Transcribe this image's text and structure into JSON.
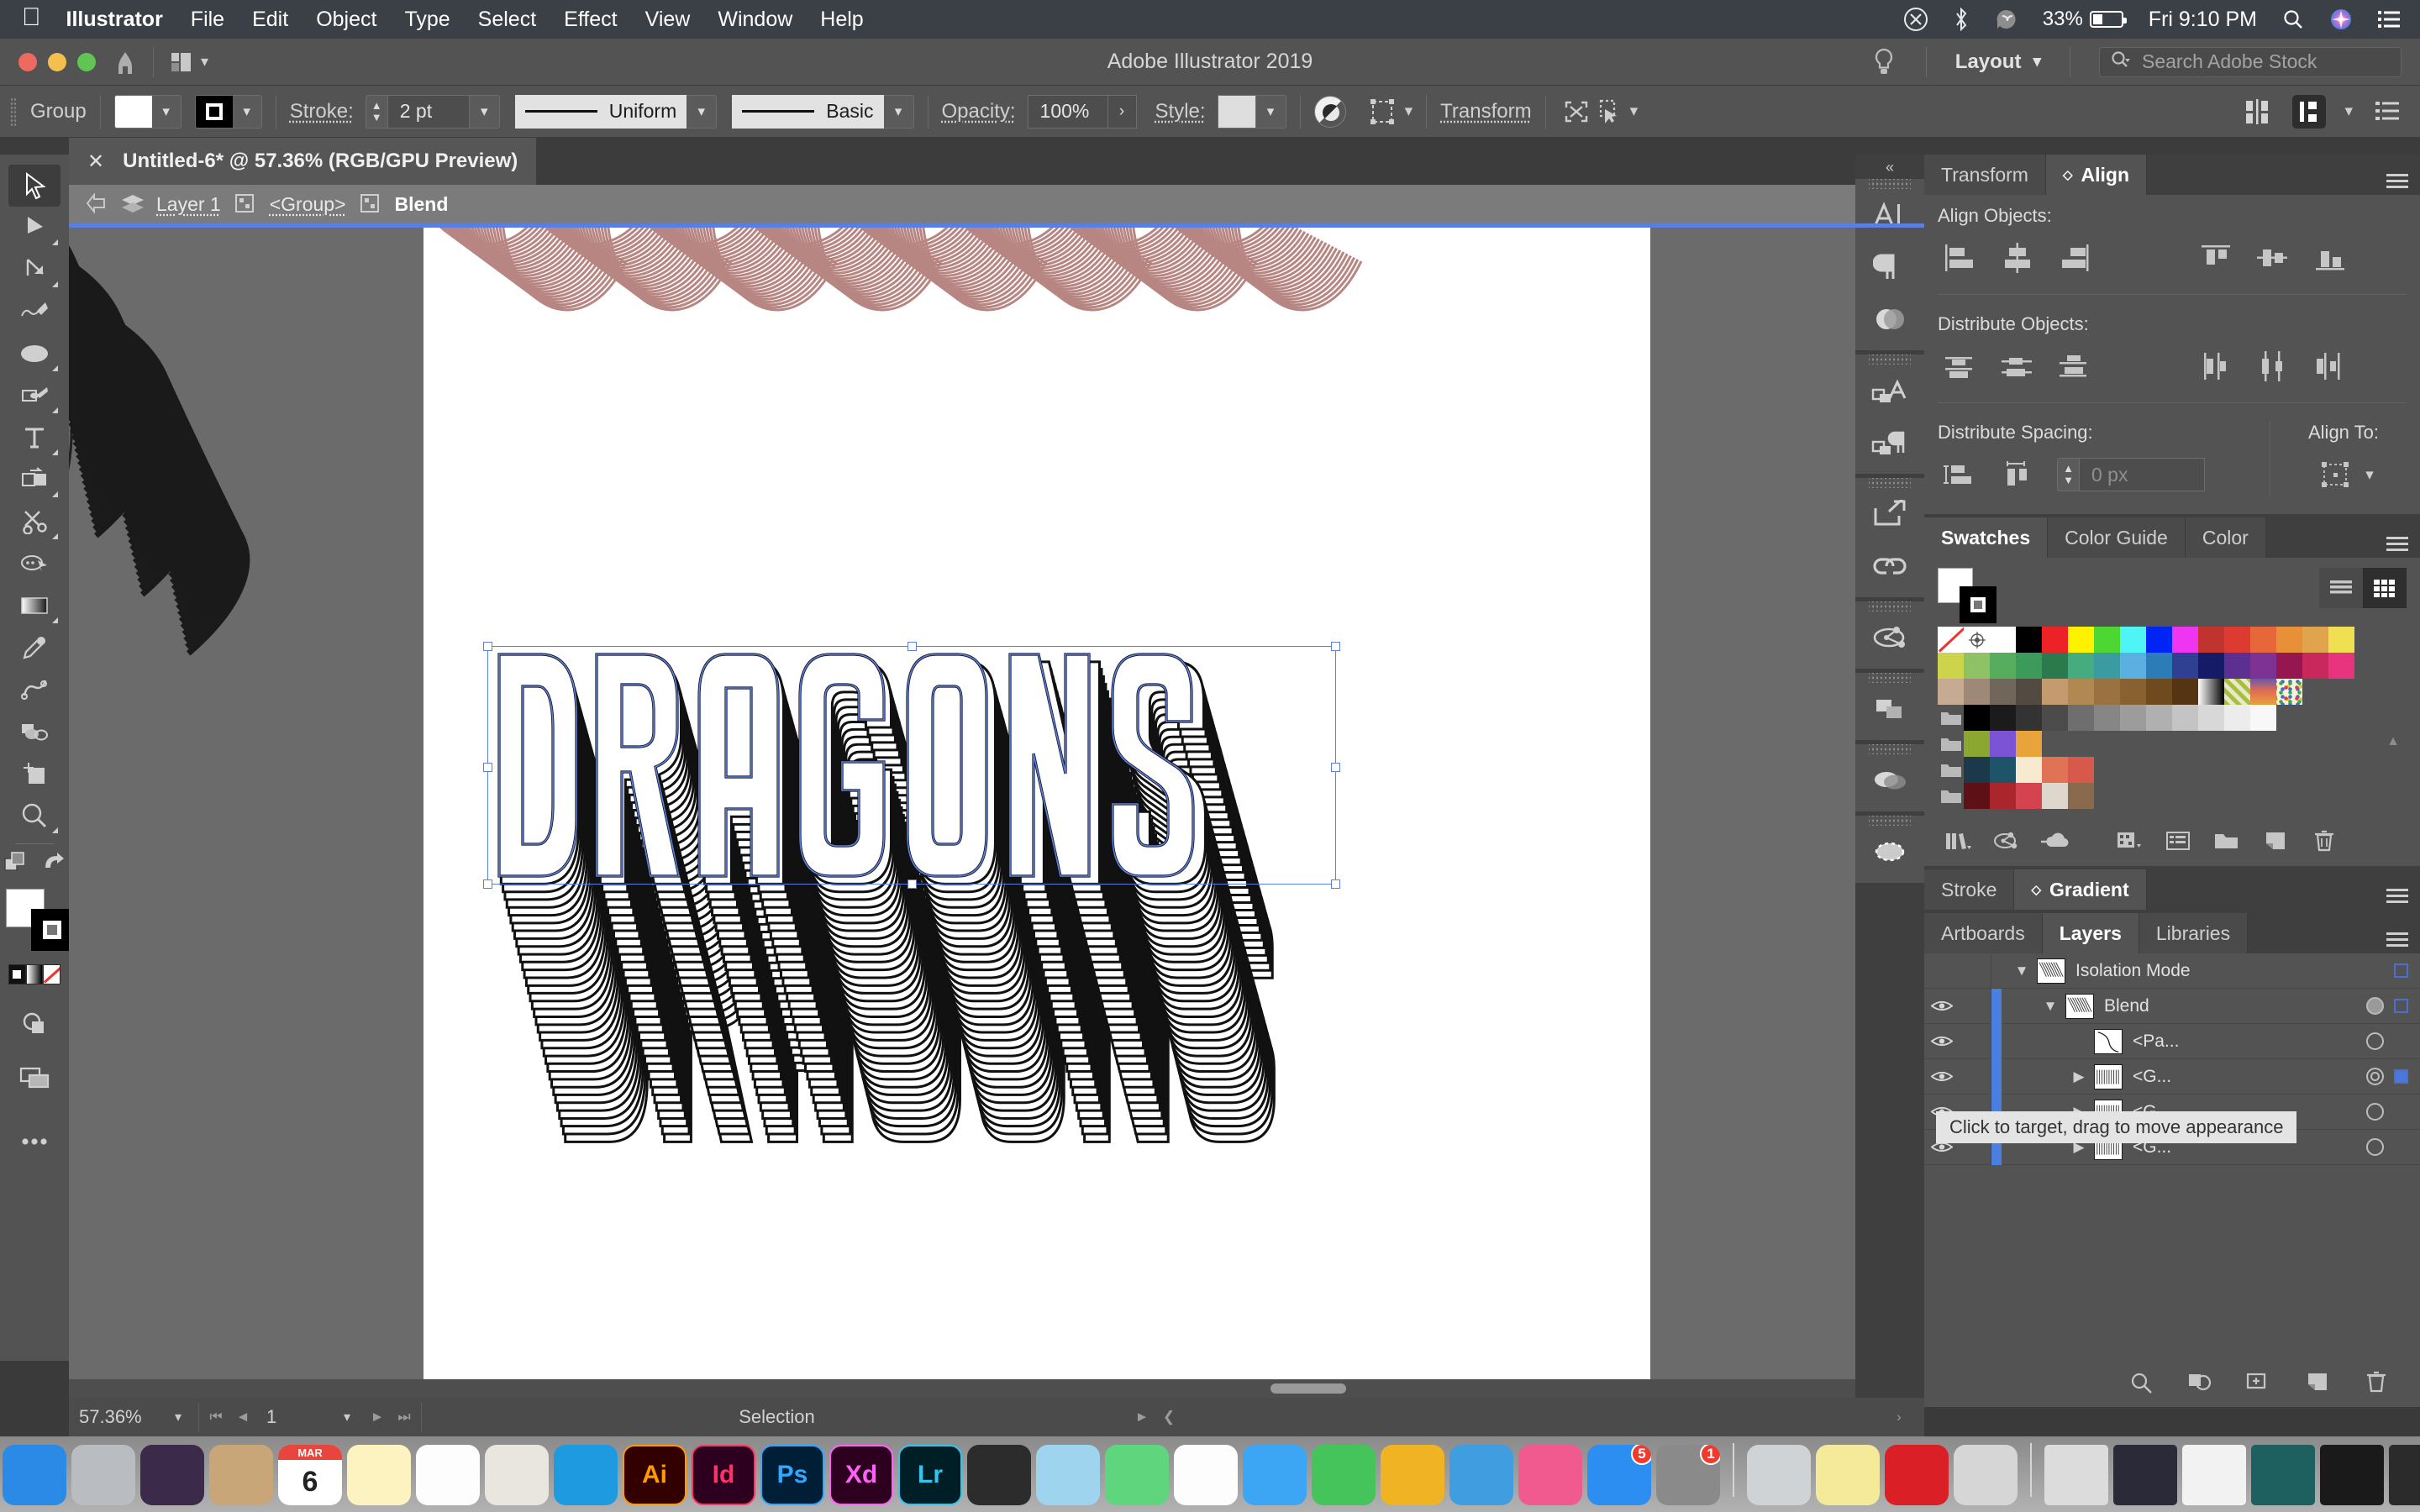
{
  "menubar": {
    "apple_icon": "apple-logo",
    "app_name": "Illustrator",
    "items": [
      "File",
      "Edit",
      "Object",
      "Type",
      "Select",
      "Effect",
      "View",
      "Window",
      "Help"
    ],
    "status": {
      "creative_cloud_icon": "creative-cloud-icon",
      "bluetooth_icon": "bluetooth-icon",
      "evernote_icon": "evernote-icon",
      "battery_percent": "33%",
      "clock": "Fri 9:10 PM",
      "search_icon": "spotlight-search-icon",
      "siri_icon": "siri-icon",
      "control_center_icon": "notification-center-icon"
    }
  },
  "titlebar": {
    "title": "Adobe Illustrator 2019",
    "home_icon": "home-icon",
    "arrange_icon": "arrange-documents-icon",
    "bulb_icon": "lightbulb-tips-icon",
    "workspace": "Layout",
    "search_placeholder": "Search Adobe Stock",
    "search_icon": "search-icon"
  },
  "controlbar": {
    "selection_label": "Group",
    "fill_label": "fill-swatch",
    "stroke_label": "stroke-swatch",
    "stroke_text": "Stroke:",
    "stroke_weight": "2 pt",
    "profile": "Uniform",
    "brush": "Basic",
    "opacity_label": "Opacity:",
    "opacity_value": "100%",
    "style_label": "Style:",
    "opacity_icon": "opacity-mask-icon",
    "recolor_icon": "recolor-artwork-icon",
    "transform_label": "Transform",
    "isolate_icon": "isolate-selected-object-icon",
    "select_similar_icon": "select-similar-objects-icon",
    "align_icon": "align-icon",
    "distribute_icon": "distribute-icon",
    "options_icon": "document-setup-icon"
  },
  "document": {
    "tab_title": "Untitled-6* @ 57.36% (RGB/GPU Preview)",
    "close_icon": "close-tab-icon"
  },
  "breadcrumb": {
    "back_icon": "back-arrow-icon",
    "layers_icon": "layers-stack-icon",
    "items": [
      {
        "label": "Layer 1",
        "current": false
      },
      {
        "label": "<Group>",
        "current": false
      },
      {
        "label": "Blend",
        "current": true
      }
    ]
  },
  "toolbar": {
    "tools": [
      {
        "name": "selection-tool",
        "selected": true,
        "has_flyout": false
      },
      {
        "name": "direct-selection-tool",
        "selected": false,
        "has_flyout": true
      },
      {
        "name": "pen-tool-anchor",
        "selected": false,
        "has_flyout": true
      },
      {
        "name": "curvature-tool",
        "selected": false,
        "has_flyout": false
      },
      {
        "name": "ellipse-tool",
        "selected": false,
        "has_flyout": true
      },
      {
        "name": "paintbrush-tool",
        "selected": false,
        "has_flyout": true
      },
      {
        "name": "type-tool",
        "selected": false,
        "has_flyout": true
      },
      {
        "name": "shape-builder-tool",
        "selected": false,
        "has_flyout": true
      },
      {
        "name": "scissors-tool",
        "selected": false,
        "has_flyout": true
      },
      {
        "name": "rotate-tool",
        "selected": false,
        "has_flyout": false
      },
      {
        "name": "gradient-tool",
        "selected": false,
        "has_flyout": true
      },
      {
        "name": "eyedropper-tool",
        "selected": false,
        "has_flyout": false
      },
      {
        "name": "blend-tool",
        "selected": false,
        "has_flyout": false
      },
      {
        "name": "symbol-sprayer-tool",
        "selected": false,
        "has_flyout": false
      },
      {
        "name": "artboard-tool",
        "selected": false,
        "has_flyout": false
      },
      {
        "name": "zoom-tool",
        "selected": false,
        "has_flyout": true
      }
    ],
    "fill_color": "#ffffff",
    "stroke_color": "#000000",
    "swap_icon": "swap-fill-stroke-icon",
    "default_icon": "default-fill-stroke-icon",
    "color_mode_icon": "color-mode-icon",
    "gradient_mode_icon": "gradient-mode-icon",
    "none_mode_icon": "none-mode-icon",
    "drawing_mode_icon": "drawing-modes-icon",
    "screen_mode_icon": "screen-mode-icon",
    "more_icon": "edit-toolbar-icon"
  },
  "canvas": {
    "artwork_text": "DRAGONS",
    "artwork_stroke_color": "#000000",
    "artwork_accent_color": "#b5807c",
    "selection_color": "#5b7fe0",
    "artboard_color": "#ffffff",
    "canvas_color": "#6b6b6b"
  },
  "statusbar": {
    "zoom": "57.36%",
    "page": "1",
    "status_text": "Selection",
    "first_icon": "first-artboard-icon",
    "prev_icon": "previous-artboard-icon",
    "next_icon": "next-artboard-icon",
    "last_icon": "last-artboard-icon"
  },
  "iconrail": {
    "collapse_icon": "collapse-panels-icon",
    "groups": [
      {
        "icons": [
          "character-panel-icon",
          "paragraph-panel-icon",
          "opacity-panel-icon"
        ]
      },
      {
        "icons": [
          "text-wrap-icon",
          "paragraph-styles-icon"
        ]
      },
      {
        "icons": [
          "export-panel-icon",
          "links-panel-icon"
        ]
      },
      {
        "icons": [
          "symbols-panel-icon"
        ]
      },
      {
        "icons": [
          "pathfinder-panel-icon"
        ]
      },
      {
        "icons": [
          "transparency-panel-icon"
        ]
      },
      {
        "icons": [
          "image-trace-panel-icon"
        ]
      }
    ]
  },
  "align_panel": {
    "tabs": [
      {
        "label": "Transform",
        "active": false
      },
      {
        "label": "Align",
        "active": true
      }
    ],
    "menu_icon": "panel-menu-icon",
    "align_objects_label": "Align Objects:",
    "distribute_objects_label": "Distribute Objects:",
    "distribute_spacing_label": "Distribute Spacing:",
    "align_to_label": "Align To:",
    "spacing_value": "0 px",
    "align_buttons": [
      "align-left-edges",
      "align-horizontal-center",
      "align-right-edges",
      "align-top-edges",
      "align-vertical-center",
      "align-bottom-edges"
    ],
    "distribute_buttons": [
      "distribute-top-edges",
      "distribute-vertical-centers",
      "distribute-bottom-edges",
      "distribute-left-edges",
      "distribute-horizontal-centers",
      "distribute-right-edges"
    ],
    "spacing_buttons": [
      "distribute-vertical-space",
      "distribute-horizontal-space"
    ],
    "align_to_icon": "align-to-selection-icon"
  },
  "swatches_panel": {
    "tabs": [
      {
        "label": "Swatches",
        "active": true
      },
      {
        "label": "Color Guide",
        "active": false
      },
      {
        "label": "Color",
        "active": false
      }
    ],
    "menu_icon": "panel-menu-icon",
    "list_view_icon": "list-view-icon",
    "grid_view_icon": "grid-view-icon",
    "rows": [
      {
        "type": "swatches",
        "colors": [
          "none",
          "registration",
          "#ffffff",
          "#000000",
          "#ec2227",
          "#fff200",
          "#4cd733",
          "#4ff4f7",
          "#0024f4",
          "#ef34f2",
          "#c0332f",
          "#dd3b32",
          "#e8673a",
          "#e79038",
          "#e0a44c",
          "#efe052"
        ]
      },
      {
        "type": "swatches",
        "colors": [
          "#ccd44b",
          "#8fc264",
          "#56ad5e",
          "#3c9b5b",
          "#2b7a4e",
          "#44ac7f",
          "#3a9ba0",
          "#5ab0e0",
          "#2c7cb8",
          "#2f3f92",
          "#151b66",
          "#5b3092",
          "#7e3294",
          "#94174f",
          "#c9285c",
          "#e8337e"
        ]
      },
      {
        "type": "swatches",
        "colors": [
          "#c6ab93",
          "#9e8877",
          "#70665a",
          "#534b42",
          "#c49b6f",
          "#b08851",
          "#9a7140",
          "#87612f",
          "#6e4a1e",
          "#543413",
          "gradient-white-black",
          "gradient-check-green",
          "gradient-sunset",
          "pattern-confetti"
        ]
      },
      {
        "type": "folder",
        "folder_icon": "swatch-group-folder",
        "colors": [
          "#000000",
          "#1b1b1b",
          "#333333",
          "#4b4b4b",
          "#6e6e6e",
          "#868686",
          "#9c9c9c",
          "#b0b0b0",
          "#c4c4c4",
          "#d8d8d8",
          "#ececec",
          "#f8f8f8"
        ]
      },
      {
        "type": "folder",
        "folder_icon": "swatch-group-folder",
        "colors": [
          "#8ba730",
          "#7b54d6",
          "#e8a43a"
        ]
      },
      {
        "type": "folder",
        "folder_icon": "swatch-group-folder",
        "colors": [
          "#1b394b",
          "#1f5468",
          "#f7ead0",
          "#e07256",
          "#d6594b"
        ]
      },
      {
        "type": "folder",
        "folder_icon": "swatch-group-folder",
        "colors": [
          "#5d1117",
          "#a8262c",
          "#d4444f",
          "#ddd7ce",
          "#8a6a4c"
        ]
      }
    ],
    "toolbar_icons": [
      "swatch-libraries-icon",
      "color-group-link-icon",
      "add-to-cc-library-icon",
      "show-swatch-kinds-icon",
      "swatch-options-icon",
      "new-color-group-icon",
      "new-swatch-icon",
      "delete-swatch-icon"
    ]
  },
  "gradient_panel": {
    "tabs": [
      {
        "label": "Stroke",
        "active": false
      },
      {
        "label": "Gradient",
        "active": true
      }
    ],
    "menu_icon": "panel-menu-icon"
  },
  "layers_panel": {
    "tabs": [
      {
        "label": "Artboards",
        "active": false
      },
      {
        "label": "Layers",
        "active": true
      },
      {
        "label": "Libraries",
        "active": false
      }
    ],
    "menu_icon": "panel-menu-icon",
    "rows": [
      {
        "name": "Isolation Mode",
        "indent": 0,
        "eye": false,
        "expanded": true,
        "arrow": "chevron-down",
        "target": "none",
        "select_square": "outline",
        "thumb": "blend-art-thumb"
      },
      {
        "name": "Blend",
        "indent": 1,
        "eye": true,
        "expanded": true,
        "arrow": "chevron-down",
        "target": "filled",
        "select_square": "outline",
        "thumb": "blend-art-thumb"
      },
      {
        "name": "<Pa...",
        "indent": 2,
        "eye": true,
        "expanded": false,
        "arrow": "none",
        "target": "empty",
        "select_square": "none",
        "thumb": "path-curve-thumb"
      },
      {
        "name": "<G...",
        "indent": 2,
        "eye": true,
        "expanded": false,
        "arrow": "chevron-right",
        "target": "double",
        "select_square": "filled",
        "thumb": "group-art-thumb"
      },
      {
        "name": "<G...",
        "indent": 2,
        "eye": true,
        "expanded": false,
        "arrow": "chevron-right",
        "target": "empty",
        "select_square": "none",
        "thumb": "group-art-thumb"
      },
      {
        "name": "<G...",
        "indent": 2,
        "eye": true,
        "expanded": false,
        "arrow": "chevron-right",
        "target": "empty",
        "select_square": "none",
        "thumb": "group-art-thumb"
      }
    ],
    "tooltip": "Click to target, drag to move appearance",
    "footer_icons": [
      "locate-object-icon",
      "make-clipping-mask-icon",
      "create-new-sublayer-icon",
      "create-new-layer-icon",
      "delete-selection-icon"
    ]
  },
  "dock": {
    "items": [
      {
        "name": "finder",
        "label": "",
        "color": "#2a8ae5",
        "running": true
      },
      {
        "name": "launchpad",
        "label": "",
        "color": "#b9bcc1",
        "running": false
      },
      {
        "name": "siri",
        "label": "",
        "color": "#3b2a4a",
        "running": false
      },
      {
        "name": "contacts",
        "label": "",
        "color": "#c8a678",
        "running": false
      },
      {
        "name": "calendar",
        "label": "6",
        "color": "#ffffff",
        "running": true
      },
      {
        "name": "notes",
        "label": "",
        "color": "#fcf3c0",
        "running": false
      },
      {
        "name": "reminders",
        "label": "",
        "color": "#fdfdfd",
        "running": false
      },
      {
        "name": "maps",
        "label": "",
        "color": "#e8e6de",
        "running": true
      },
      {
        "name": "safari",
        "label": "",
        "color": "#1d9ae0",
        "running": true
      },
      {
        "name": "illustrator",
        "label": "Ai",
        "color": "#330000",
        "running": true
      },
      {
        "name": "indesign",
        "label": "Id",
        "color": "#2e001f",
        "running": false
      },
      {
        "name": "photoshop",
        "label": "Ps",
        "color": "#001e36",
        "running": false
      },
      {
        "name": "xd",
        "label": "Xd",
        "color": "#2e001f",
        "running": false
      },
      {
        "name": "lightroom",
        "label": "Lr",
        "color": "#001e26",
        "running": false
      },
      {
        "name": "figma",
        "label": "",
        "color": "#2c2c2c",
        "running": false
      },
      {
        "name": "procreate",
        "label": "",
        "color": "#9fd4ef",
        "running": false
      },
      {
        "name": "spotify",
        "label": "",
        "color": "#5fd67e",
        "running": true
      },
      {
        "name": "photos",
        "label": "",
        "color": "#fdfdfd",
        "running": false
      },
      {
        "name": "messages",
        "label": "",
        "color": "#3ca6f4",
        "running": false
      },
      {
        "name": "facetime",
        "label": "",
        "color": "#45c45b",
        "running": false
      },
      {
        "name": "pages",
        "label": "",
        "color": "#f0b323",
        "running": true
      },
      {
        "name": "keynote",
        "label": "",
        "color": "#3f9de0",
        "running": false
      },
      {
        "name": "itunes",
        "label": "",
        "color": "#f05a8e",
        "running": false
      },
      {
        "name": "app-store",
        "label": "",
        "color": "#2c8ef0",
        "badge": "5",
        "running": false
      },
      {
        "name": "system-preferences",
        "label": "",
        "color": "#8a8a8a",
        "badge": "1",
        "running": false
      },
      {
        "name": "preview-folder",
        "label": "",
        "color": "#cfd3d6",
        "running": true
      },
      {
        "name": "stickies",
        "label": "",
        "color": "#f5ea9a",
        "running": true
      },
      {
        "name": "creative-cloud",
        "label": "",
        "color": "#da1f26",
        "running": false
      },
      {
        "name": "printer",
        "label": "",
        "color": "#d6d6d6",
        "running": true
      },
      {
        "name": "window-1",
        "label": "",
        "color": "#dcdcdc",
        "running": false
      },
      {
        "name": "window-2",
        "label": "",
        "color": "#2a2a38",
        "running": false
      },
      {
        "name": "window-3",
        "label": "",
        "color": "#f2f2f2",
        "running": false
      },
      {
        "name": "window-4",
        "label": "",
        "color": "#1e5f5f",
        "running": false
      },
      {
        "name": "window-5",
        "label": "",
        "color": "#1a1a1a",
        "running": false
      },
      {
        "name": "window-6",
        "label": "",
        "color": "#2b2b2b",
        "running": false
      },
      {
        "name": "trash",
        "label": "",
        "color": "#c8ccd0",
        "running": false
      }
    ]
  }
}
